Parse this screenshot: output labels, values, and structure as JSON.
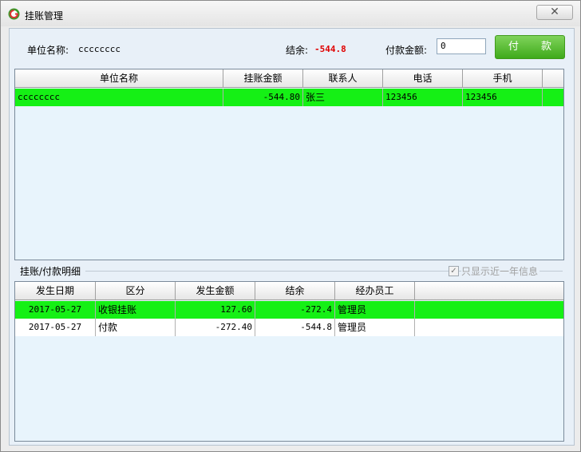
{
  "window": {
    "title": "挂账管理",
    "close_glyph": "✕"
  },
  "header": {
    "unit_label": "单位名称:",
    "unit_value": "cccccccc",
    "balance_label": "结余:",
    "balance_value": "-544.8",
    "payment_label": "付款金额:",
    "payment_value": "0",
    "pay_button": "付 款"
  },
  "units_table": {
    "columns": [
      "单位名称",
      "挂账金额",
      "联系人",
      "电话",
      "手机"
    ],
    "rows": [
      {
        "name": "cccccccc",
        "amount": "-544.80",
        "contact": "张三",
        "phone": "123456",
        "mobile": "123456"
      }
    ]
  },
  "detail": {
    "section_title": "挂账/付款明细",
    "filter_label": "只显示近一年信息",
    "filter_checked": true,
    "columns": [
      "发生日期",
      "区分",
      "发生金额",
      "结余",
      "经办员工"
    ],
    "rows": [
      {
        "date": "2017-05-27",
        "type": "收银挂账",
        "amount": "127.60",
        "balance": "-272.4",
        "staff": "管理员"
      },
      {
        "date": "2017-05-27",
        "type": "付款",
        "amount": "-272.40",
        "balance": "-544.8",
        "staff": "管理员"
      }
    ]
  },
  "colors": {
    "highlight_row": "#15f015",
    "grid_bg": "#e8f4fc",
    "pay_button": "#3faa1a",
    "balance_text": "#e00000"
  }
}
